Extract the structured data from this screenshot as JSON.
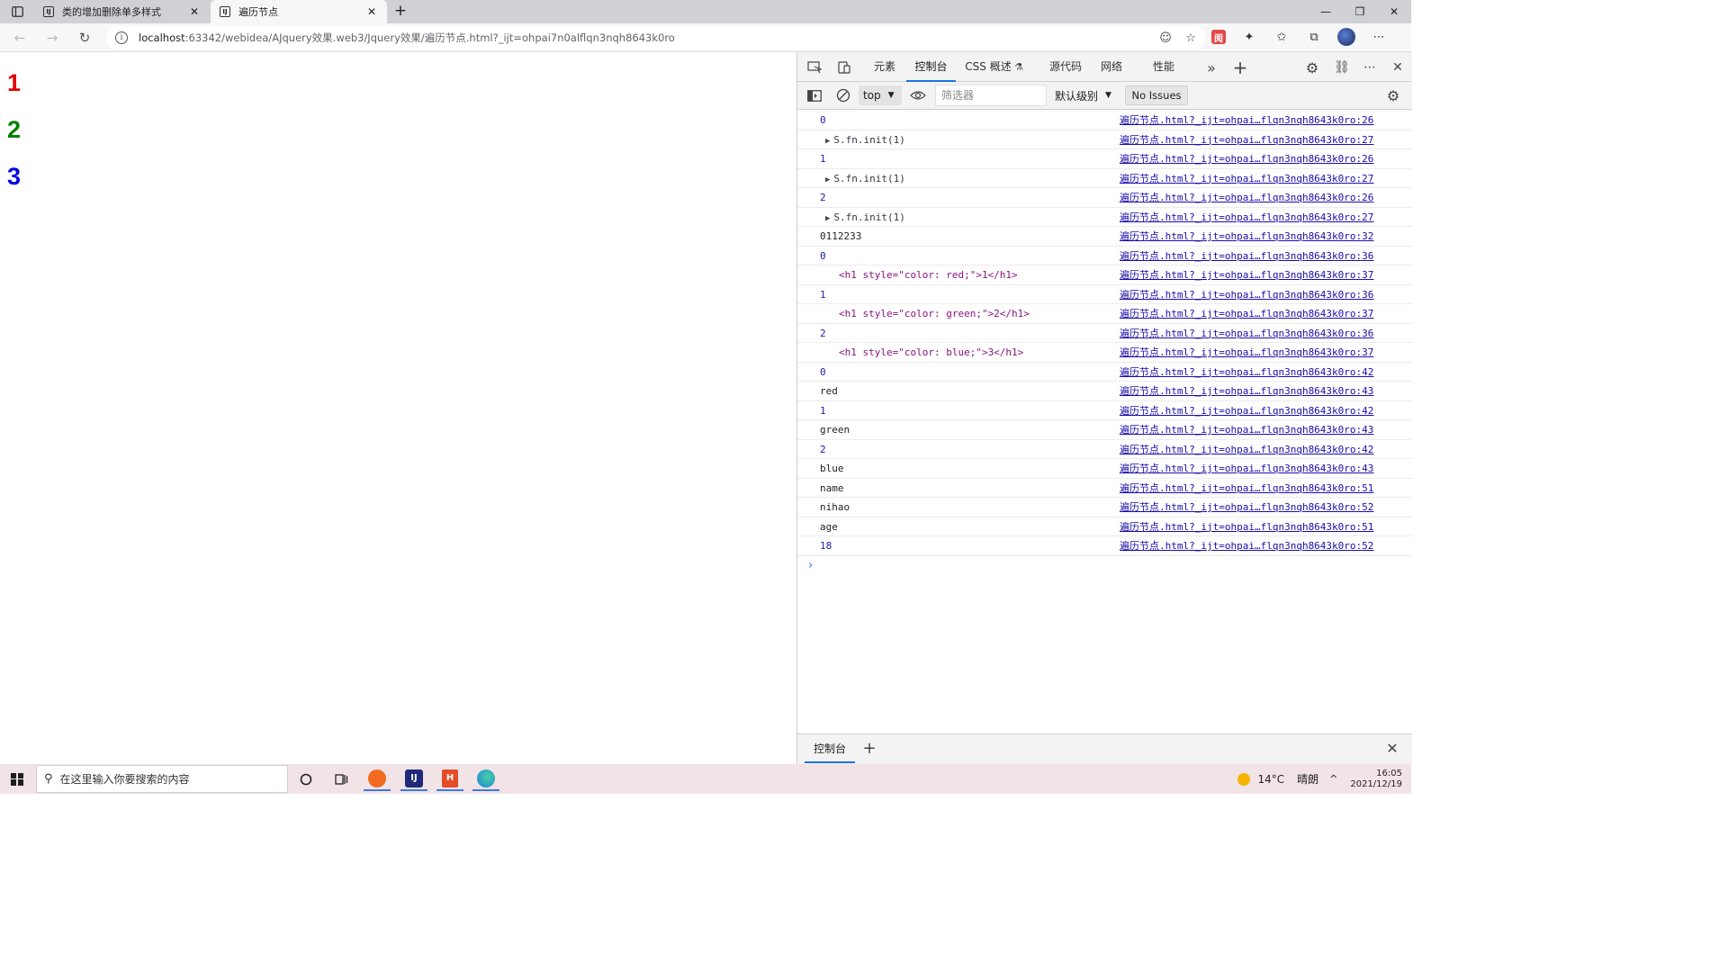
{
  "browser": {
    "tabs": [
      {
        "title": "类的增加删除单多样式",
        "favicon": "intellij-page-icon"
      },
      {
        "title": "遍历节点",
        "favicon": "intellij-page-icon"
      }
    ],
    "url_host": "localhost",
    "url_rest": ":63342/webidea/AJquery效果.web3/Jquery效果/遍历节点.html?_ijt=ohpai7n0alflqn3nqh8643k0ro"
  },
  "page": {
    "headings": [
      {
        "text": "1",
        "color": "#e00000"
      },
      {
        "text": "2",
        "color": "#008000"
      },
      {
        "text": "3",
        "color": "#0000e0"
      }
    ]
  },
  "devtools": {
    "tabs": [
      "元素",
      "控制台",
      "CSS 概述",
      "源代码",
      "网络",
      "性能"
    ],
    "selected_tab": "控制台",
    "context": "top",
    "filter_placeholder": "筛选器",
    "level": "默认级别",
    "issues": "No Issues",
    "source_prefix": "遍历节点.html?_ijt=ohpai…flqn3nqh8643k0ro:",
    "console": [
      {
        "type": "num",
        "text": "0",
        "line": "26"
      },
      {
        "type": "obj",
        "text": "S.fn.init(1)",
        "line": "27"
      },
      {
        "type": "num",
        "text": "1",
        "line": "26"
      },
      {
        "type": "obj",
        "text": "S.fn.init(1)",
        "line": "27"
      },
      {
        "type": "num",
        "text": "2",
        "line": "26"
      },
      {
        "type": "obj",
        "text": "S.fn.init(1)",
        "line": "27"
      },
      {
        "type": "str",
        "text": "0112233",
        "line": "32"
      },
      {
        "type": "num",
        "text": "0",
        "line": "36"
      },
      {
        "type": "el",
        "text": "<h1 style=\"color: red;\">1</h1>",
        "line": "37"
      },
      {
        "type": "num",
        "text": "1",
        "line": "36"
      },
      {
        "type": "el",
        "text": "<h1 style=\"color: green;\">2</h1>",
        "line": "37"
      },
      {
        "type": "num",
        "text": "2",
        "line": "36"
      },
      {
        "type": "el",
        "text": "<h1 style=\"color: blue;\">3</h1>",
        "line": "37"
      },
      {
        "type": "num",
        "text": "0",
        "line": "42"
      },
      {
        "type": "str",
        "text": "red",
        "line": "43"
      },
      {
        "type": "num",
        "text": "1",
        "line": "42"
      },
      {
        "type": "str",
        "text": "green",
        "line": "43"
      },
      {
        "type": "num",
        "text": "2",
        "line": "42"
      },
      {
        "type": "str",
        "text": "blue",
        "line": "43"
      },
      {
        "type": "str",
        "text": "name",
        "line": "51"
      },
      {
        "type": "str",
        "text": "nihao",
        "line": "52"
      },
      {
        "type": "str",
        "text": "age",
        "line": "51"
      },
      {
        "type": "num",
        "text": "18",
        "line": "52"
      }
    ],
    "drawer_tab": "控制台"
  },
  "taskbar": {
    "search_placeholder": "在这里输入你要搜索的内容",
    "temperature": "14°C",
    "weather": "晴朗",
    "time": "16:05",
    "date": "2021/12/19"
  }
}
